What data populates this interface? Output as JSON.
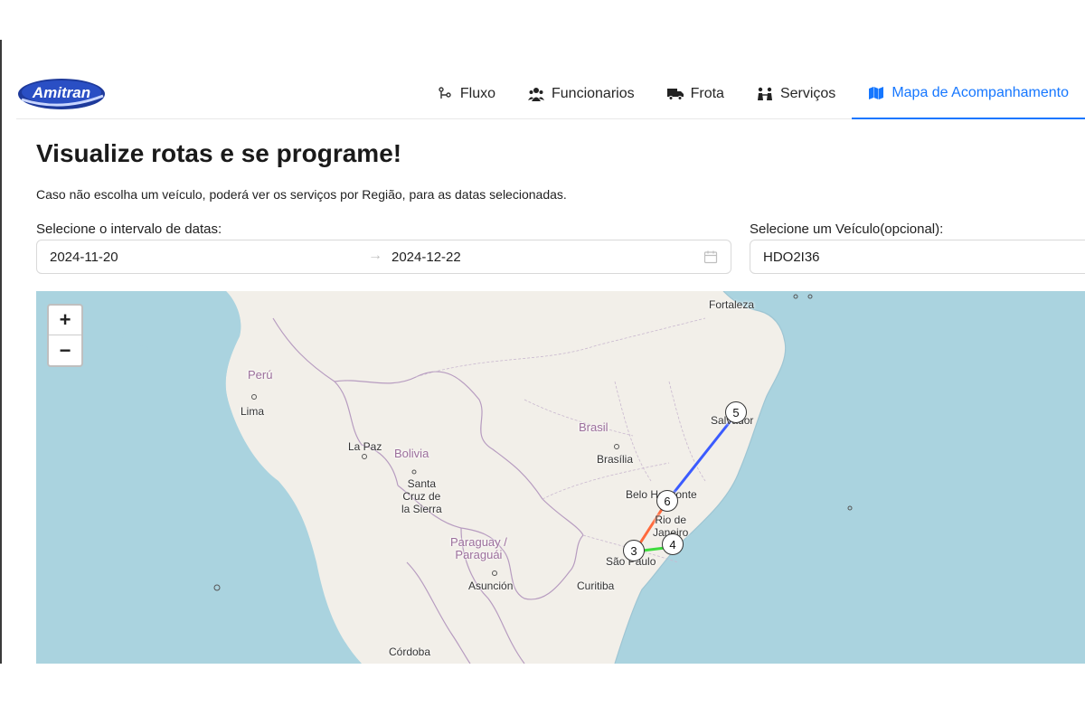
{
  "brand": {
    "logo_text": "Amitran"
  },
  "nav": {
    "items": [
      {
        "label": "Fluxo",
        "icon": "flow-icon"
      },
      {
        "label": "Funcionarios",
        "icon": "team-icon"
      },
      {
        "label": "Frota",
        "icon": "truck-icon"
      },
      {
        "label": "Serviços",
        "icon": "services-icon"
      },
      {
        "label": "Mapa de Acompanhamento",
        "icon": "map-icon",
        "active": true
      }
    ]
  },
  "page": {
    "title": "Visualize rotas e se programe!",
    "description": "Caso não escolha um veículo, poderá ver os serviços por Região, para as datas selecionadas."
  },
  "filters": {
    "date_label": "Selecione o intervalo de datas:",
    "start_date": "2024-11-20",
    "end_date": "2024-12-22",
    "vehicle_label": "Selecione um Veículo(opcional):",
    "vehicle_value": "HDO2I36"
  },
  "map": {
    "zoom_in": "+",
    "zoom_out": "−",
    "labels": {
      "fortaleza": "Fortaleza",
      "peru": "Perú",
      "lima": "Lima",
      "la_paz": "La Paz",
      "bolivia": "Bolivia",
      "santa_cruz": "Santa\nCruz de\nla Sierra",
      "brasil": "Brasil",
      "brasilia": "Brasília",
      "salvador": "Salvador",
      "belo_horizonte": "Belo Horizonte",
      "rio": "Rio de\nJaneiro",
      "paraguay": "Paraguay /\nParaguái",
      "asuncion": "Asunción",
      "sao_paulo": "São Paulo",
      "curitiba": "Curitiba",
      "cordoba": "Córdoba"
    },
    "markers": [
      "5",
      "6",
      "3",
      "4"
    ],
    "route_colors": {
      "salvador_bh": "#3b5bff",
      "bh_sp": "#ff6a3d",
      "sp_rio": "#3ddc3d"
    }
  }
}
